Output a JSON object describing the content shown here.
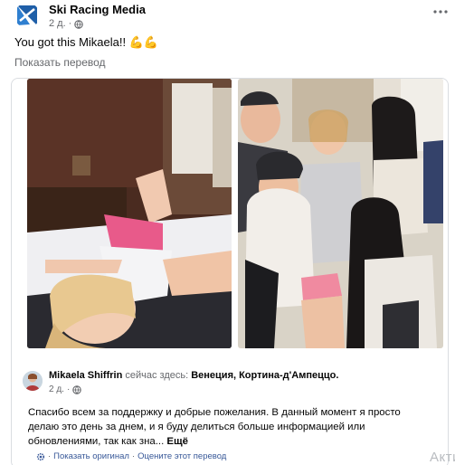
{
  "post": {
    "author": "Ski Racing Media",
    "time": "2 д.",
    "caption": "You got this Mikaela!! 💪💪",
    "translate_link": "Показать перевод"
  },
  "original": {
    "author": "Mikaela Shiffrin",
    "location_prefix": "сейчас здесь:",
    "location": "Венеция, Кортина-д'Ампеццо.",
    "time": "2 д.",
    "text": "Спасибо всем за поддержку и добрые пожелания. В данный момент я просто делаю это день за днем, и я буду делиться больше информацией или обновлениями, так как зна...",
    "see_more": "Ещё",
    "show_original": "Показать оригинал",
    "rate_translation": "Оцените этот перевод",
    "separator": "·"
  },
  "overlay": {
    "watermark": "Акти"
  },
  "icons": {
    "more": "more-horizontal-icon",
    "privacy": "globe-icon",
    "settings": "gear-icon"
  },
  "colors": {
    "link_blue": "#385898",
    "muted": "#65676b",
    "border": "#dadde1",
    "logo_blue": "#1f5fa8"
  }
}
